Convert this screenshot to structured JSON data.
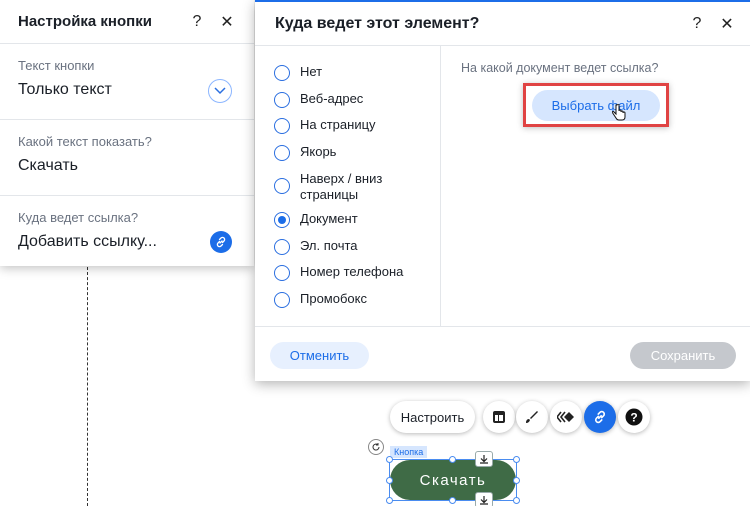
{
  "left_panel": {
    "title": "Настройка кнопки",
    "help": "?",
    "close": "✕",
    "text_section": {
      "label": "Текст кнопки",
      "value": "Только текст"
    },
    "which_text_section": {
      "label": "Какой текст показать?",
      "value": "Скачать"
    },
    "link_section": {
      "label": "Куда ведет ссылка?",
      "value": "Добавить ссылку..."
    }
  },
  "dialog": {
    "title": "Куда ведет этот элемент?",
    "help": "?",
    "close": "✕",
    "options": [
      {
        "label": "Нет",
        "checked": false
      },
      {
        "label": "Веб-адрес",
        "checked": false
      },
      {
        "label": "На страницу",
        "checked": false
      },
      {
        "label": "Якорь",
        "checked": false
      },
      {
        "label": "Наверх / вниз страницы",
        "checked": false
      },
      {
        "label": "Документ",
        "checked": true
      },
      {
        "label": "Эл. почта",
        "checked": false
      },
      {
        "label": "Номер телефона",
        "checked": false
      },
      {
        "label": "Промобокс",
        "checked": false
      }
    ],
    "question": "На какой документ ведет ссылка?",
    "choose_file": "Выбрать файл",
    "cancel": "Отменить",
    "save": "Сохранить"
  },
  "toolbar": {
    "customize": "Настроить",
    "icons": [
      "layout-icon",
      "brush-icon",
      "animation-icon",
      "link-icon",
      "help-icon"
    ]
  },
  "canvas_button": {
    "tag": "Кнопка",
    "label": "Скачать",
    "color": "#3f6b46"
  },
  "colors": {
    "accent": "#1c6de8",
    "highlight": "#e04343"
  }
}
